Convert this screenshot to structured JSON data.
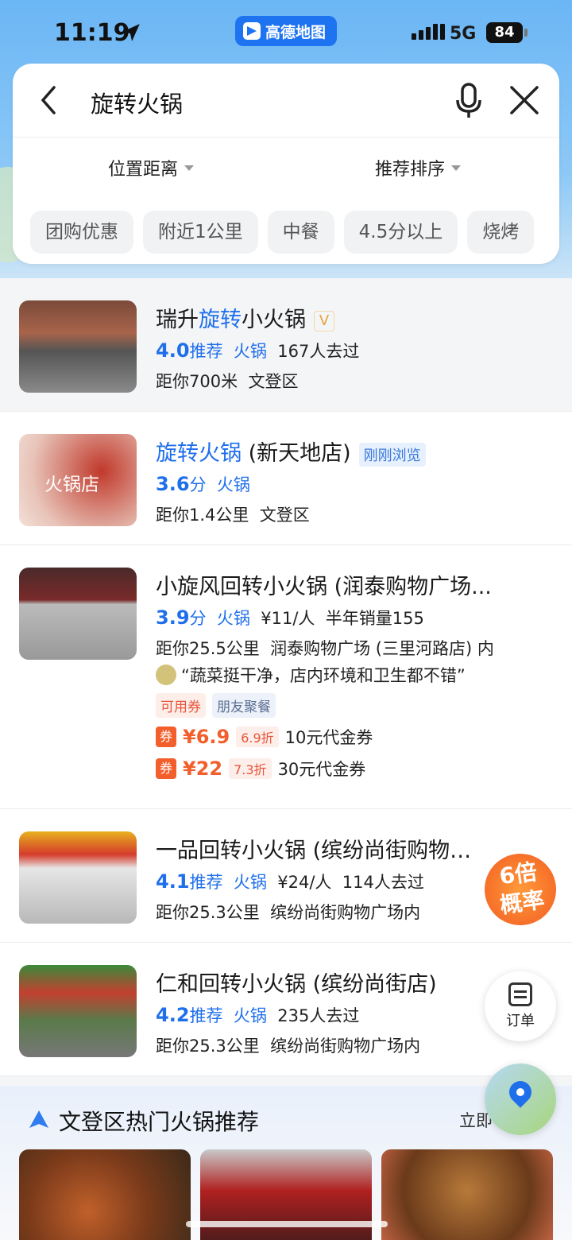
{
  "status_bar": {
    "time": "11:19",
    "app_name": "高德地图",
    "network": "5G",
    "battery": "84"
  },
  "search": {
    "query": "旋转火锅",
    "filters": [
      "位置距离",
      "推荐排序"
    ],
    "chips": [
      "团购优惠",
      "附近1公里",
      "中餐",
      "4.5分以上",
      "烧烤"
    ]
  },
  "results": [
    {
      "name_pre": "瑞升",
      "name_hl": "旋转",
      "name_post": "小火锅",
      "badge": "V",
      "score": "4.0",
      "score_suffix": "推荐",
      "category": "火锅",
      "extra": "167人去过",
      "distance": "距你700米",
      "district": "文登区"
    },
    {
      "name_pre": "",
      "name_hl": "旋转火锅",
      "name_post": " (新天地店)",
      "badge": "刚刚浏览",
      "score": "3.6",
      "score_suffix": "分",
      "category": "火锅",
      "distance": "距你1.4公里",
      "district": "文登区",
      "thumb_text": "火锅店"
    },
    {
      "name": "小旋风回转小火锅 (润泰购物广场...",
      "score": "3.9",
      "score_suffix": "分",
      "category": "火锅",
      "price": "¥11/人",
      "extra": "半年销量155",
      "distance": "距你25.5公里",
      "district": "润泰购物广场 (三里河路店) 内",
      "review": "“蔬菜挺干净，店内环境和卫生都不错”",
      "labels": [
        "可用券",
        "朋友聚餐"
      ],
      "deals": [
        {
          "q": "券",
          "price": "¥6.9",
          "discount": "6.9折",
          "desc": "10元代金券"
        },
        {
          "q": "券",
          "price": "¥22",
          "discount": "7.3折",
          "desc": "30元代金券"
        }
      ]
    },
    {
      "name": "一品回转小火锅 (缤纷尚街购物广...",
      "score": "4.1",
      "score_suffix": "推荐",
      "category": "火锅",
      "price": "¥24/人",
      "extra": "114人去过",
      "distance": "距你25.3公里",
      "district": "缤纷尚街购物广场内"
    },
    {
      "name": "仁和回转小火锅 (缤纷尚街店)",
      "score": "4.2",
      "score_suffix": "推荐",
      "category": "火锅",
      "extra": "235人去过",
      "distance": "距你25.3公里",
      "district": "缤纷尚街购物广场内"
    }
  ],
  "promo": {
    "line1": "6倍",
    "line2": "概率"
  },
  "order_button": "订单",
  "hot_section": {
    "title": "文登区热门火锅推荐",
    "more": "立即"
  },
  "colors": {
    "accent": "#1f6feb",
    "deal": "#f25f2c"
  }
}
